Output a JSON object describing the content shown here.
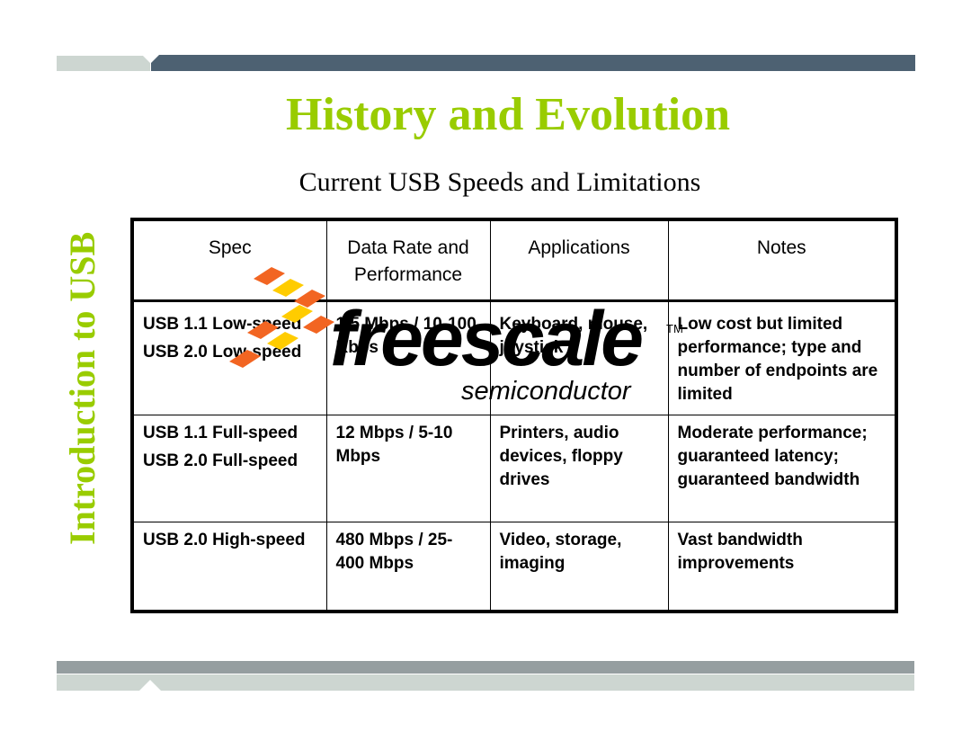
{
  "slide": {
    "title": "History and Evolution",
    "subtitle": "Current USB Speeds and Limitations",
    "side_label": "Introduction to USB",
    "accent_color": "#99cc00"
  },
  "table": {
    "headers": [
      "Spec",
      "Data Rate and Performance",
      "Applications",
      "Notes"
    ],
    "rows": [
      {
        "spec": [
          "USB 1.1 Low-speed",
          "USB 2.0 Low-speed"
        ],
        "data_rate": "1.5 Mbps / 10-100 Kbps",
        "applications": "Keyboard, mouse, joystick",
        "notes": "Low cost but limited performance; type and number of endpoints are limited"
      },
      {
        "spec": [
          "USB 1.1 Full-speed",
          "USB 2.0 Full-speed"
        ],
        "data_rate": "12 Mbps / 5-10 Mbps",
        "applications": "Printers, audio devices, floppy drives",
        "notes": "Moderate performance; guaranteed latency; guaranteed bandwidth"
      },
      {
        "spec": [
          "USB 2.0 High-speed"
        ],
        "data_rate": "480 Mbps / 25-400 Mbps",
        "applications": "Video, storage, imaging",
        "notes": "Vast bandwidth improvements"
      }
    ]
  },
  "logo": {
    "wordmark": "freescale",
    "tagline": "semiconductor",
    "trademark": "TM",
    "colors": {
      "orange": "#f26522",
      "yellow": "#ffcc00"
    }
  }
}
